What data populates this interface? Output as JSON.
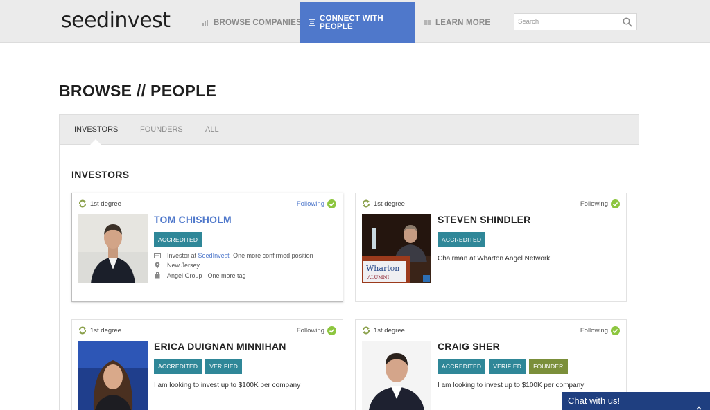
{
  "header": {
    "logo": "seedinvest",
    "nav": [
      {
        "label": "BROWSE COMPANIES",
        "icon": "chart-icon"
      },
      {
        "label": "CONNECT WITH PEOPLE",
        "icon": "people-icon",
        "active": true
      },
      {
        "label": "LEARN MORE",
        "icon": "book-icon"
      }
    ],
    "search": {
      "placeholder": "Search",
      "value": ""
    }
  },
  "page_title": "BROWSE // PEOPLE",
  "tabs": [
    {
      "label": "INVESTORS",
      "active": true
    },
    {
      "label": "FOUNDERS"
    },
    {
      "label": "ALL"
    }
  ],
  "section_heading": "INVESTORS",
  "cards": [
    {
      "degree": "1st degree",
      "following": "Following",
      "name": "TOM CHISHOLM",
      "badges": [
        "ACCREDITED"
      ],
      "meta": {
        "position_prefix": "Investor at ",
        "position_company": "SeedInvest",
        "position_suffix": " · One more confirmed position",
        "location": "New Jersey",
        "tags": "Angel Group · One more tag"
      }
    },
    {
      "degree": "1st degree",
      "following": "Following",
      "name": "STEVEN SHINDLER",
      "badges": [
        "ACCREDITED"
      ],
      "description": "Chairman at Wharton Angel Network",
      "photo_text": {
        "brand": "Wharton",
        "sub": "ALUMNI"
      }
    },
    {
      "degree": "1st degree",
      "following": "Following",
      "name": "ERICA DUIGNAN MINNIHAN",
      "badges": [
        "ACCREDITED",
        "VERIFIED"
      ],
      "description": "I am looking to invest up to $100K per company"
    },
    {
      "degree": "1st degree",
      "following": "Following",
      "name": "CRAIG SHER",
      "badges": [
        "ACCREDITED",
        "VERIFIED",
        "FOUNDER"
      ],
      "description": "I am looking to invest up to $100K per company"
    }
  ],
  "chat": {
    "label": "Chat with us!"
  },
  "colors": {
    "brand_blue": "#4f78cb",
    "badge_teal": "#2f8798",
    "badge_green": "#7b8f3a",
    "check_green": "#8dc63f",
    "chat_navy": "#1f3f80"
  }
}
